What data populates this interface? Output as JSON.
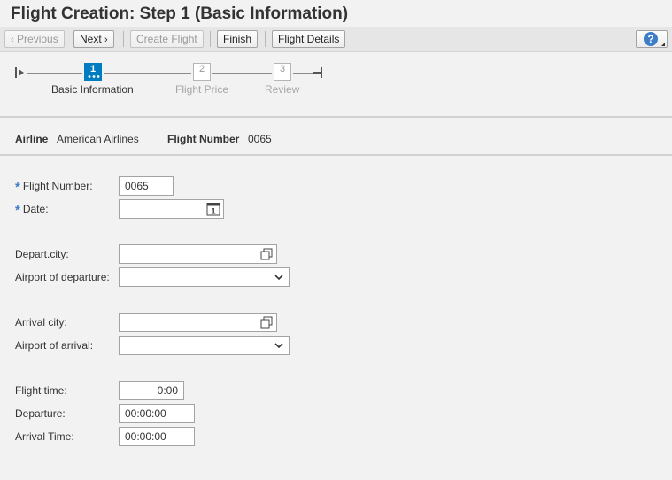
{
  "window": {
    "title": "Flight Creation: Step 1  (Basic Information)"
  },
  "toolbar": {
    "previous_label": "Previous",
    "next_label": "Next",
    "create_flight_label": "Create Flight",
    "finish_label": "Finish",
    "flight_details_label": "Flight Details",
    "help_label": "?"
  },
  "roadmap": {
    "steps": [
      {
        "number": "1",
        "label": "Basic Information",
        "active": true
      },
      {
        "number": "2",
        "label": "Flight Price",
        "active": false
      },
      {
        "number": "3",
        "label": "Review",
        "active": false
      }
    ]
  },
  "info": {
    "airline_label": "Airline",
    "airline_value": "American Airlines",
    "flight_number_label": "Flight Number",
    "flight_number_value": "0065"
  },
  "form": {
    "required_marker": "*",
    "flight_number": {
      "label": "Flight Number:",
      "value": "0065"
    },
    "date": {
      "label": "Date:",
      "value": ""
    },
    "depart_city": {
      "label": "Depart.city:",
      "value": ""
    },
    "airport_departure": {
      "label": "Airport of departure:",
      "value": ""
    },
    "arrival_city": {
      "label": "Arrival city:",
      "value": ""
    },
    "airport_arrival": {
      "label": "Airport of arrival:",
      "value": ""
    },
    "flight_time": {
      "label": "Flight time:",
      "value": "0:00"
    },
    "departure": {
      "label": "Departure:",
      "value": "00:00:00"
    },
    "arrival_time": {
      "label": "Arrival Time:",
      "value": "00:00:00"
    }
  },
  "icons": {
    "calendar_day": "1"
  },
  "colors": {
    "accent": "#007cc0",
    "required": "#3d7cc9",
    "background": "#f2f2f2"
  }
}
